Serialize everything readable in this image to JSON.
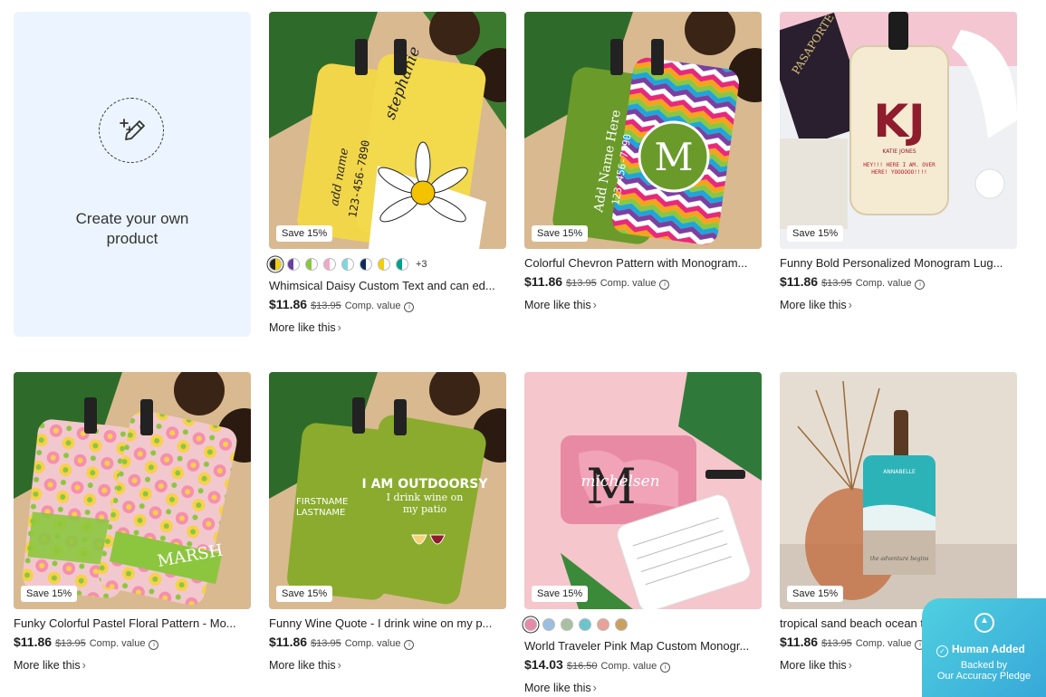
{
  "create": {
    "label": "Create your own product"
  },
  "products": [
    {
      "save": "Save 15%",
      "title": "Whimsical Daisy Custom Text and can ed...",
      "price": "$11.86",
      "old_price": "$13.95",
      "comp": "Comp. value",
      "more": "More like this",
      "swatches": [
        "#f4d000",
        "#6a3fa0",
        "#8cc63f",
        "#f4a7c8",
        "#7fd6e0",
        "#0d2a5a",
        "#f4d000",
        "#00a08a"
      ],
      "extra": "+3"
    },
    {
      "save": "Save 15%",
      "title": "Colorful Chevron Pattern with Monogram...",
      "price": "$11.86",
      "old_price": "$13.95",
      "comp": "Comp. value",
      "more": "More like this"
    },
    {
      "save": "Save 15%",
      "title": "Funny Bold Personalized Monogram Lug...",
      "price": "$11.86",
      "old_price": "$13.95",
      "comp": "Comp. value",
      "more": "More like this"
    },
    {
      "save": "Save 15%",
      "title": "Funky Colorful Pastel Floral Pattern - Mo...",
      "price": "$11.86",
      "old_price": "$13.95",
      "comp": "Comp. value",
      "more": "More like this"
    },
    {
      "save": "Save 15%",
      "title": "Funny Wine Quote - I drink wine on my p...",
      "price": "$11.86",
      "old_price": "$13.95",
      "comp": "Comp. value",
      "more": "More like this"
    },
    {
      "save": "Save 15%",
      "title": "World Traveler Pink Map Custom Monogr...",
      "price": "$14.03",
      "old_price": "$16.50",
      "comp": "Comp. value",
      "more": "More like this",
      "swatches": [
        "#e58aa8",
        "#9bbfe0",
        "#a9c0a0",
        "#6cc4cc",
        "#e8a29a",
        "#c9a060"
      ]
    },
    {
      "save": "Save 15%",
      "title": "tropical sand beach ocean the adventure...",
      "price": "$11.86",
      "old_price": "$13.95",
      "comp": "Comp. value",
      "more": "More like this"
    }
  ],
  "art_text": {
    "daisy_name": "stephanie",
    "daisy_add_name": "add name",
    "daisy_phone": "123-456-7890",
    "chevron_name": "Add Name Here",
    "chevron_phone": "123-456-7890",
    "chevron_monogram": "M",
    "kj_passport": "PASAPORTE",
    "kj_monogram": "KJ",
    "kj_name": "KATIE JONES",
    "kj_msg": "HEY!!! HERE I AM. OVER HERE! YOOOOOO!!!!",
    "floral_name": "MARSH",
    "wine_name": "FIRSTNAME LASTNAME",
    "wine_quote1": "I AM OUTDOORSY",
    "wine_quote2": "I drink wine on my patio",
    "pink_monogram": "M",
    "pink_name": "michelsen",
    "beach_name": "ANNABELLE",
    "beach_script": "the adventure begins"
  },
  "widget": {
    "title": "Human Added",
    "line1": "Backed by",
    "line2": "Our Accuracy Pledge"
  }
}
